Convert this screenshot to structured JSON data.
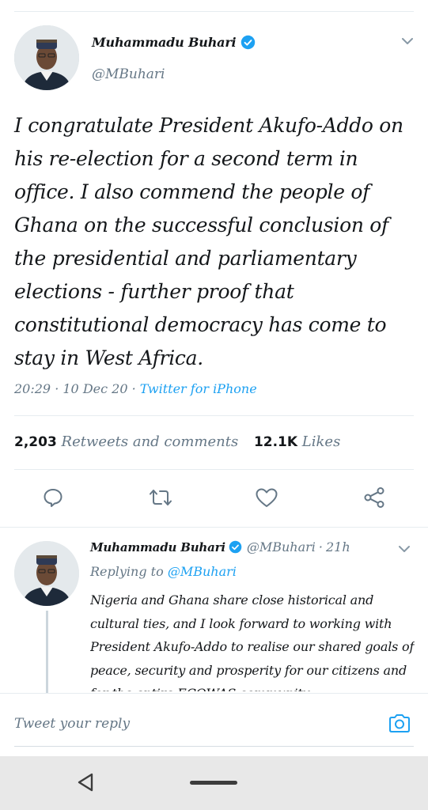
{
  "tweet": {
    "author_name": "Muhammadu Buhari",
    "author_handle": "@MBuhari",
    "text": "I congratulate President Akufo-Addo on his re-election for a second term in office. I also commend the people of Ghana on the successful conclusion of the presidential and parliamentary elections - further proof that constitutional democracy has come to stay in West Africa.",
    "time": "20:29",
    "date": "10 Dec 20",
    "source": "Twitter for iPhone",
    "retweets_count": "2,203",
    "retweets_label": "Retweets and comments",
    "likes_count": "12.1K",
    "likes_label": "Likes"
  },
  "reply_tweet": {
    "author_name": "Muhammadu Buhari",
    "author_handle": "@MBuhari",
    "age": "21h",
    "replying_prefix": "Replying to",
    "replying_to": "@MBuhari",
    "text": "Nigeria and Ghana share close historical and cultural ties, and I look forward to working with President Akufo-Addo to realise our shared goals of peace, security and prosperity for our citizens and for the entire ECOWAS community."
  },
  "composer": {
    "placeholder": "Tweet your reply"
  },
  "icons": {
    "verified": "verified-badge-icon",
    "menu": "chevron-down-icon",
    "reply": "reply-icon",
    "retweet": "retweet-icon",
    "like": "heart-icon",
    "share": "share-icon",
    "camera": "camera-icon",
    "nav_back": "back-triangle-icon"
  },
  "colors": {
    "accent": "#1da1f2",
    "text": "#14171a",
    "secondary": "#657786"
  }
}
